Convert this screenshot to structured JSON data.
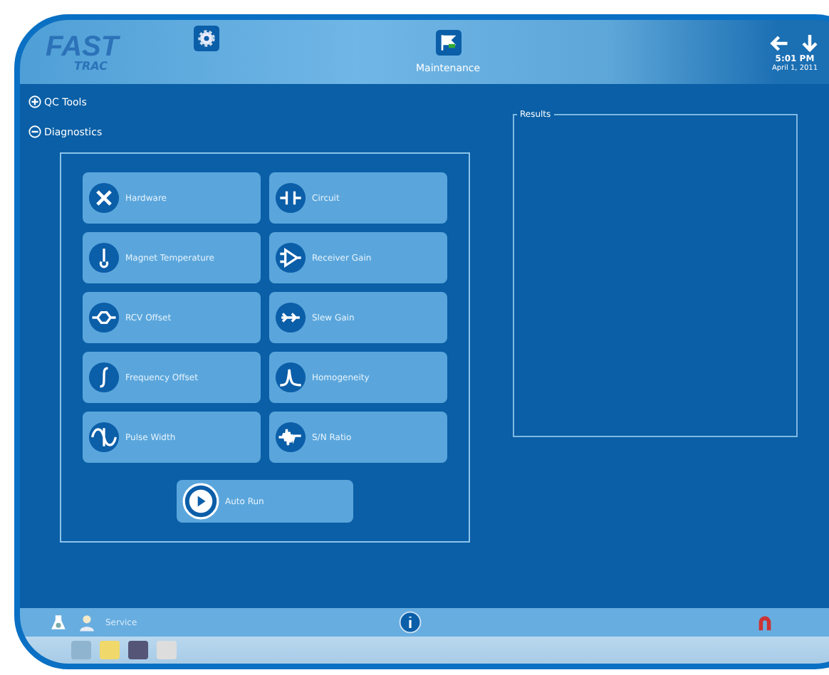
{
  "header": {
    "logo": {
      "line1": "FAST",
      "line2": "TRAC"
    },
    "title": "Maintenance",
    "time": "5:01 PM",
    "date": "April 1, 2011"
  },
  "tree": [
    {
      "label": "QC Tools",
      "expanded": false
    },
    {
      "label": "Diagnostics",
      "expanded": true
    }
  ],
  "tests": [
    {
      "label": "Hardware",
      "kind": "cross"
    },
    {
      "label": "Circuit",
      "kind": "circuit"
    },
    {
      "label": "Magnet Temperature",
      "kind": "thermometer"
    },
    {
      "label": "Receiver Gain",
      "kind": "amplifier"
    },
    {
      "label": "RCV Offset",
      "kind": "coil"
    },
    {
      "label": "Slew Gain",
      "kind": "arrows"
    },
    {
      "label": "Frequency Offset",
      "kind": "integral"
    },
    {
      "label": "Homogeneity",
      "kind": "peak"
    },
    {
      "label": "Pulse Width",
      "kind": "sine"
    },
    {
      "label": "S/N Ratio",
      "kind": "noise"
    }
  ],
  "auto_run": {
    "label": "Auto Run"
  },
  "results": {
    "title": "Results"
  },
  "footer": {
    "user": "Service"
  }
}
